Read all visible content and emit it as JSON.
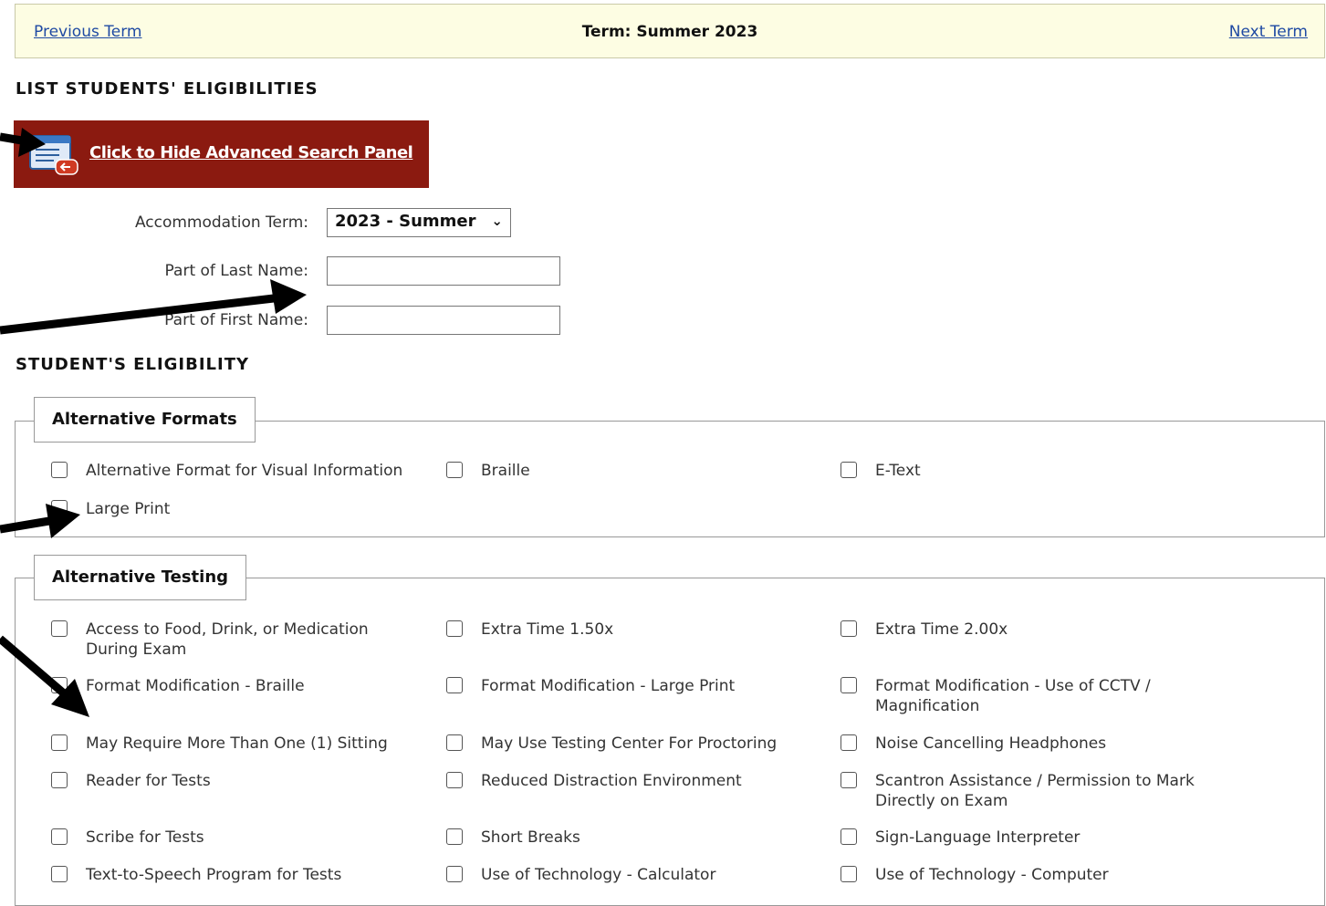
{
  "term_bar": {
    "prev_label": "Previous Term",
    "title": "Term: Summer 2023",
    "next_label": "Next Term"
  },
  "list_heading": "LIST STUDENTS' ELIGIBILITIES",
  "advanced_button": {
    "label": "Click to Hide Advanced Search Panel",
    "icon": "search-panel-icon"
  },
  "form": {
    "term_label": "Accommodation Term:",
    "term_value": "2023 - Summer",
    "last_name_label": "Part of Last Name:",
    "last_name_value": "",
    "first_name_label": "Part of First Name:",
    "first_name_value": ""
  },
  "eligibility_heading": "STUDENT'S ELIGIBILITY",
  "groups": [
    {
      "legend": "Alternative Formats",
      "options": [
        "Alternative Format for Visual Information",
        "Braille",
        "E-Text",
        "Large Print"
      ]
    },
    {
      "legend": "Alternative Testing",
      "options": [
        "Access to Food, Drink, or Medication|During Exam",
        "Extra Time 1.50x",
        "Extra Time 2.00x",
        "Format Modification - Braille",
        "Format Modification - Large Print",
        "Format Modification - Use of CCTV /|Magnification",
        "May Require More Than One (1) Sitting",
        "May Use Testing Center For Proctoring",
        "Noise Cancelling Headphones",
        "Reader for Tests",
        "Reduced Distraction Environment",
        "Scantron Assistance / Permission to Mark|Directly on Exam",
        "Scribe for Tests",
        "Short Breaks",
        "Sign-Language Interpreter",
        "Text-to-Speech Program for Tests",
        "Use of Technology - Calculator",
        "Use of Technology - Computer"
      ]
    }
  ],
  "colors": {
    "term_bar_bg": "#fdfde3",
    "link": "#1f4aa3",
    "button_bg": "#8b1a10"
  }
}
